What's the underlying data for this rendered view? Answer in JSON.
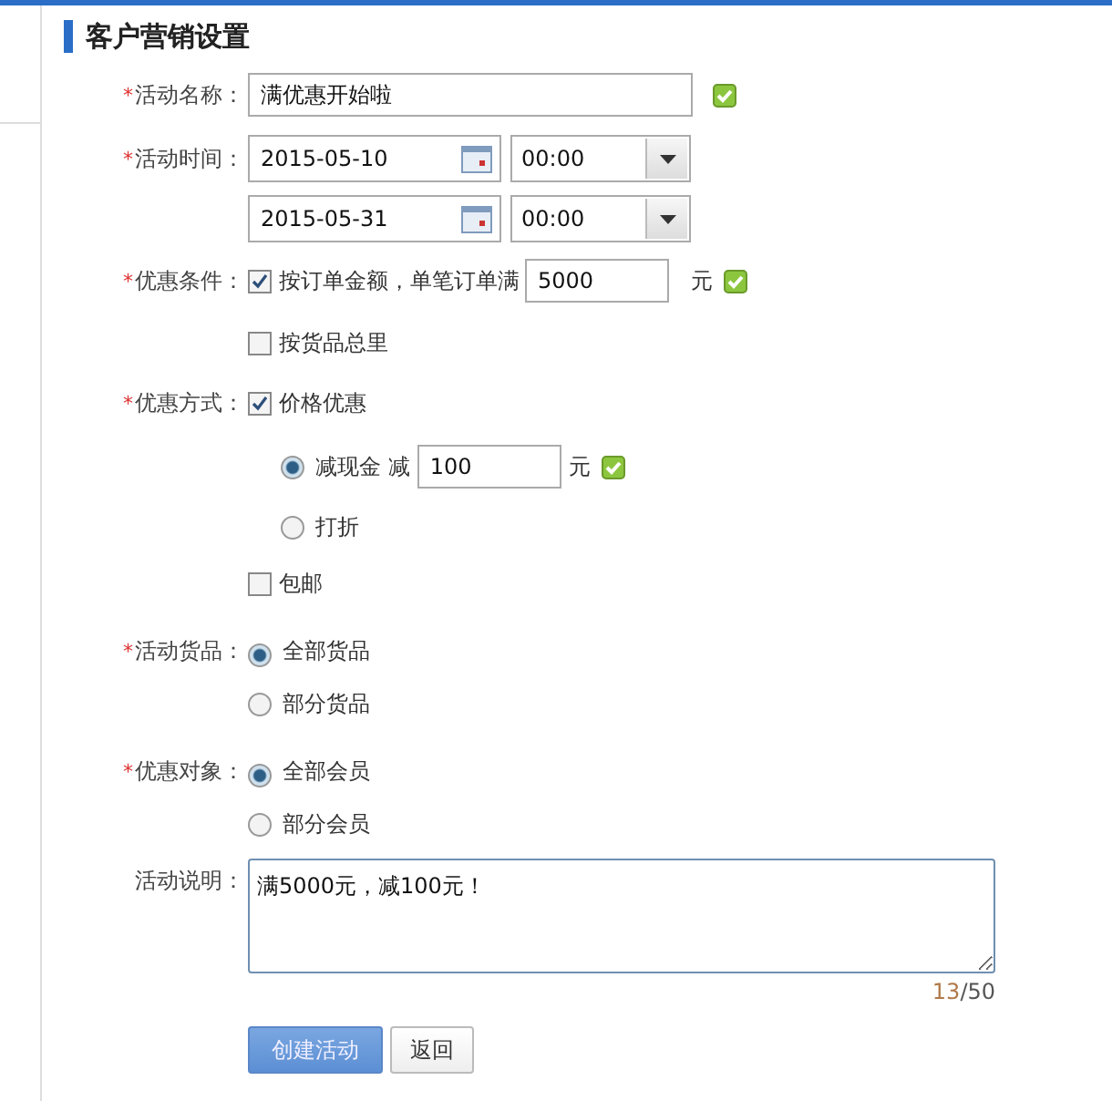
{
  "title": "客户营销设置",
  "name": {
    "label": "活动名称：",
    "required": "*",
    "value": "满优惠开始啦",
    "valid": true
  },
  "time": {
    "label": "活动时间：",
    "required": "*",
    "ranges": [
      {
        "date": "2015-05-10",
        "time": "00:00"
      },
      {
        "date": "2015-05-31",
        "time": "00:00"
      }
    ]
  },
  "condition": {
    "label": "优惠条件：",
    "required": "*",
    "options": [
      {
        "label": "按订单金额，单笔订单满",
        "checked": true,
        "amount": "5000",
        "unit": "元",
        "valid": true
      },
      {
        "label": "按货品总里",
        "checked": false
      }
    ]
  },
  "method": {
    "label": "优惠方式：",
    "required": "*",
    "price": {
      "label": "价格优惠",
      "checked": true,
      "choices": [
        {
          "label": "减现金 减",
          "selected": true,
          "amount": "100",
          "unit": "元",
          "valid": true
        },
        {
          "label": "打折",
          "selected": false
        }
      ]
    },
    "shipping": {
      "label": "包邮",
      "checked": false
    }
  },
  "goods": {
    "label": "活动货品：",
    "required": "*",
    "choices": [
      {
        "label": "全部货品",
        "selected": true
      },
      {
        "label": "部分货品",
        "selected": false
      }
    ]
  },
  "members": {
    "label": "优惠对象：",
    "required": "*",
    "choices": [
      {
        "label": "全部会员",
        "selected": true
      },
      {
        "label": "部分会员",
        "selected": false
      }
    ]
  },
  "description": {
    "label": "活动说明：",
    "value": "满5000元，减100元！",
    "count": "13",
    "max": "/50"
  },
  "buttons": [
    {
      "label": "创建活动",
      "kind": "primary"
    },
    {
      "label": "返回",
      "kind": "default"
    }
  ]
}
